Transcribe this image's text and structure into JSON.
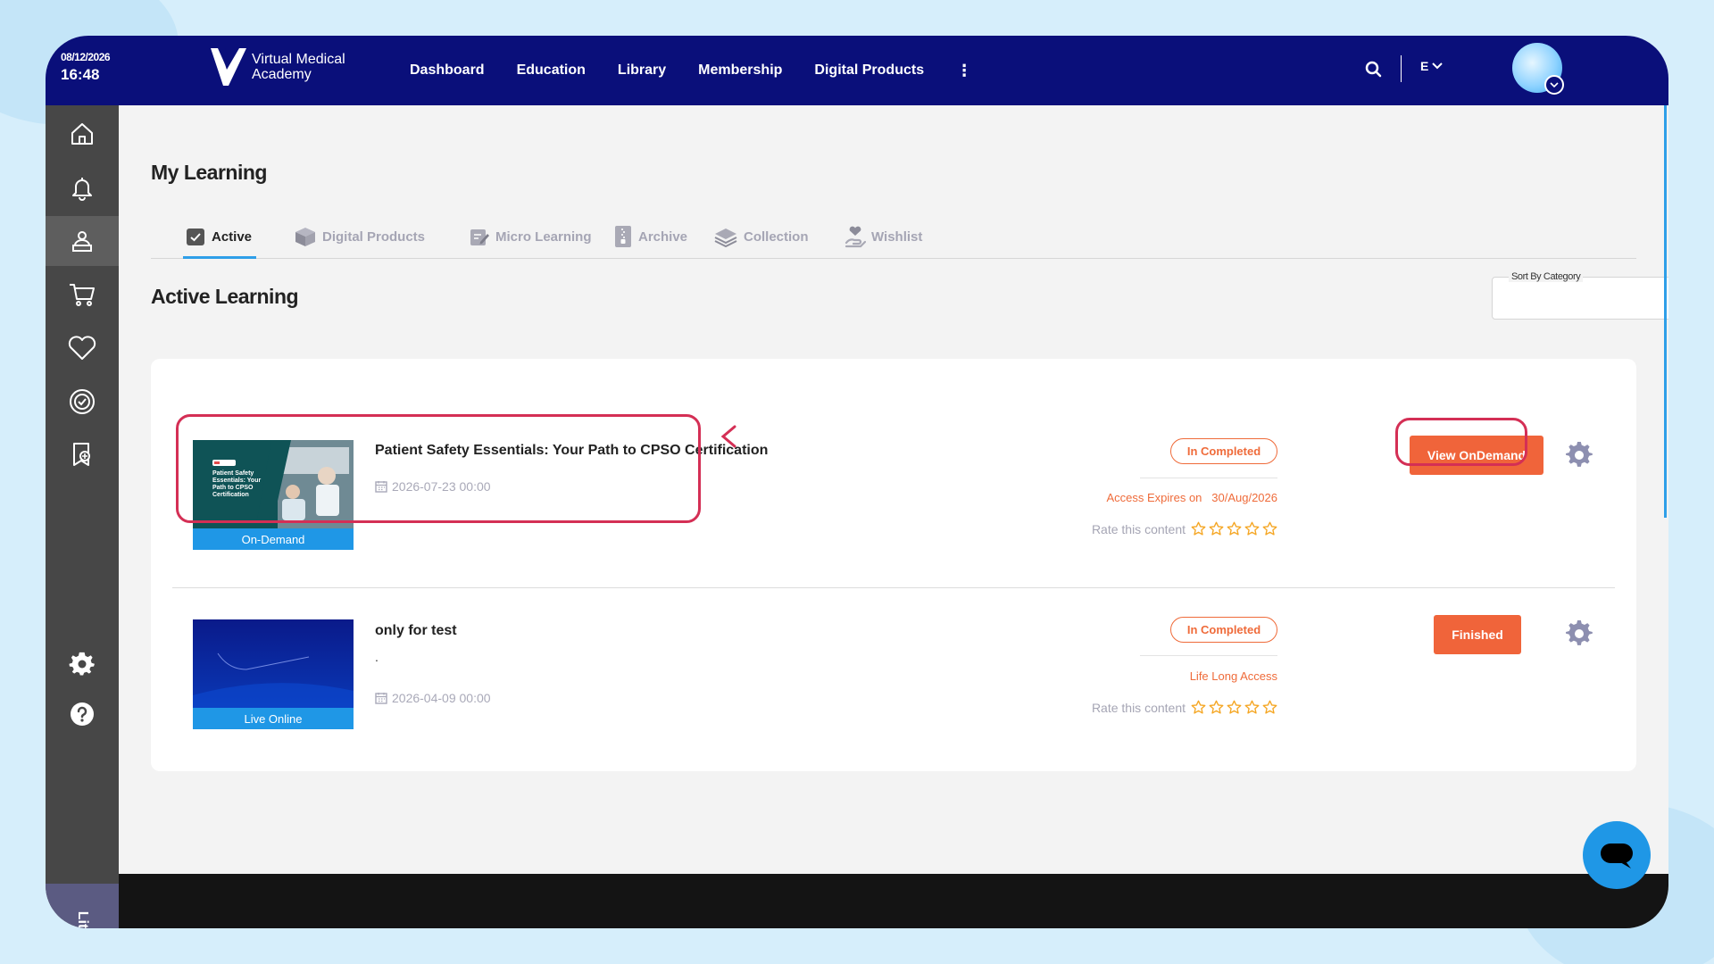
{
  "clock": {
    "date": "08/12/2026",
    "time": "16:48"
  },
  "brand": {
    "line1": "Virtual Medical",
    "line2": "Academy"
  },
  "nav": {
    "items": [
      "Dashboard",
      "Education",
      "Library",
      "Membership",
      "Digital Products"
    ],
    "more": "⋮",
    "language": "E"
  },
  "sidebar": {
    "items": [
      "home-icon",
      "bell-icon",
      "my-learning-icon",
      "cart-icon",
      "heart-icon",
      "certificate-icon",
      "credentials-icon"
    ],
    "bottom": [
      "settings-icon",
      "help-icon"
    ],
    "lite_label": "Lite"
  },
  "page": {
    "title": "My Learning",
    "tabs": [
      {
        "label": "Active",
        "icon": "check-box-icon",
        "active": true
      },
      {
        "label": "Digital Products",
        "icon": "box-icon",
        "active": false
      },
      {
        "label": "Micro Learning",
        "icon": "clipboard-pen-icon",
        "active": false
      },
      {
        "label": "Archive",
        "icon": "archive-file-icon",
        "active": false
      },
      {
        "label": "Collection",
        "icon": "layers-icon",
        "active": false
      },
      {
        "label": "Wishlist",
        "icon": "hand-heart-icon",
        "active": false
      }
    ],
    "section_title": "Active Learning",
    "sort_label": "Sort By Category",
    "sort_value": ""
  },
  "courses": [
    {
      "title": "Patient Safety Essentials: Your Path to CPSO Certification",
      "date": "2026-07-23 00:00",
      "thumb_badge": "On-Demand",
      "thumb_text": "Patient Safety Essentials: Your Path to CPSO Certification",
      "status": "In Completed",
      "access_label": "Access Expires on",
      "access_date": "30/Aug/2026",
      "rate_label": "Rate this content",
      "action": "View OnDemand"
    },
    {
      "title": "only for test",
      "subtitle": ".",
      "date": "2026-04-09 00:00",
      "thumb_badge": "Live Online",
      "status": "In Completed",
      "access_text": "Life Long Access",
      "rate_label": "Rate this content",
      "action": "Finished"
    }
  ],
  "colors": {
    "topbar": "#0a0f7a",
    "sidebar": "#474747",
    "accent_blue": "#1f97e6",
    "orange": "#f0643a",
    "annotation_red": "#d42f55",
    "star": "#f5a623"
  }
}
